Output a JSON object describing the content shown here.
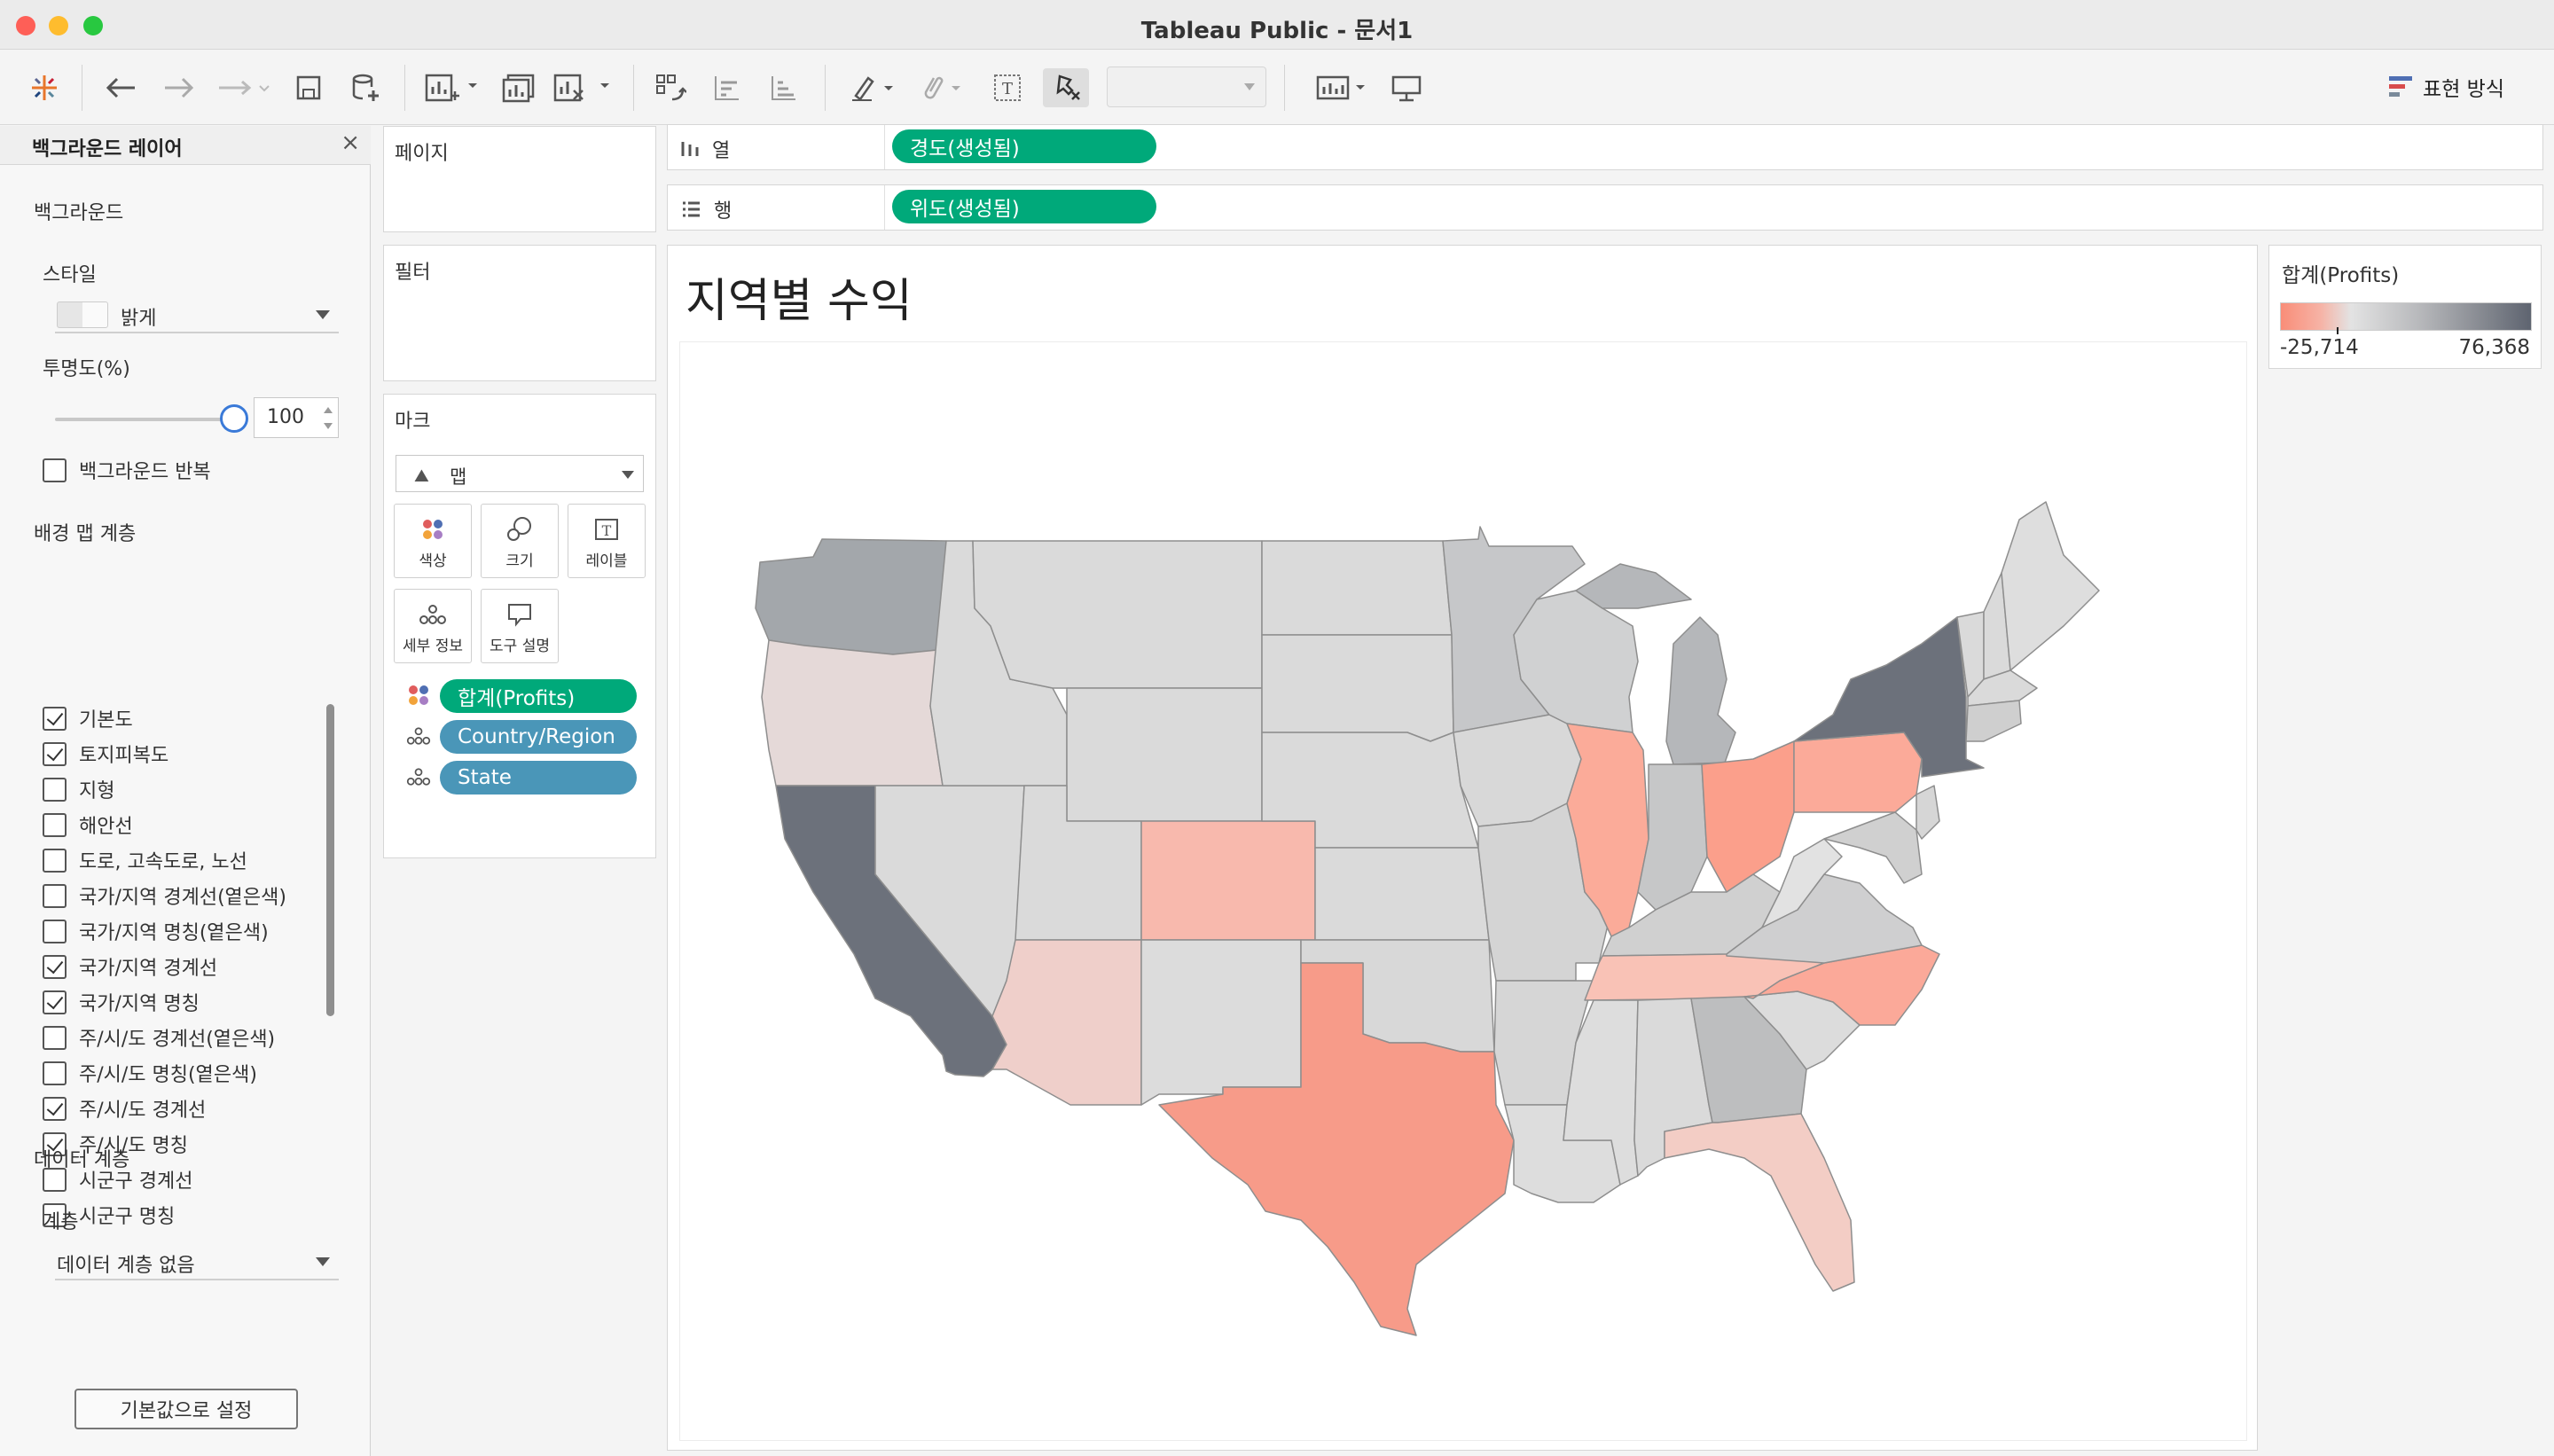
{
  "window": {
    "title": "Tableau Public - 문서1"
  },
  "toolbar": {
    "show_me_label": "표현 방식"
  },
  "background_panel": {
    "title": "백그라운드 레이어",
    "background_section": "백그라운드",
    "style_label": "스타일",
    "style_value": "밝게",
    "opacity_label": "투명도(%)",
    "opacity_value": "100",
    "opacity": 1.0,
    "repeat_label": "백그라운드 반복",
    "repeat_checked": false,
    "map_layers_section": "배경 맵 계층",
    "layers": [
      {
        "label": "기본도",
        "checked": true
      },
      {
        "label": "토지피복도",
        "checked": true
      },
      {
        "label": "지형",
        "checked": false
      },
      {
        "label": "해안선",
        "checked": false
      },
      {
        "label": "도로, 고속도로, 노선",
        "checked": false
      },
      {
        "label": "국가/지역 경계선(옅은색)",
        "checked": false
      },
      {
        "label": "국가/지역 명칭(옅은색)",
        "checked": false
      },
      {
        "label": "국가/지역 경계선",
        "checked": true
      },
      {
        "label": "국가/지역 명칭",
        "checked": true
      },
      {
        "label": "주/시/도 경계선(옅은색)",
        "checked": false
      },
      {
        "label": "주/시/도 명칭(옅은색)",
        "checked": false
      },
      {
        "label": "주/시/도 경계선",
        "checked": true
      },
      {
        "label": "주/시/도 명칭",
        "checked": true
      },
      {
        "label": "시군구 경계선",
        "checked": false
      },
      {
        "label": "시군구 명칭",
        "checked": false
      }
    ],
    "data_layer_section": "데이터 계층",
    "layer_label": "계층",
    "layer_value": "데이터 계층 없음",
    "reset_button": "기본값으로 설정"
  },
  "cards": {
    "pages": "페이지",
    "filters": "필터",
    "marks": "마크",
    "mark_type": "맵",
    "mark_buttons": {
      "color": "색상",
      "size": "크기",
      "label": "레이블",
      "detail": "세부 정보",
      "tooltip": "도구 설명"
    },
    "mark_pills": [
      "합계(Profits)",
      "Country/Region",
      "State"
    ]
  },
  "shelves": {
    "columns_label": "열",
    "columns_pill": "경도(생성됨)",
    "rows_label": "행",
    "rows_pill": "위도(생성됨)"
  },
  "view": {
    "title": "지역별 수익"
  },
  "legend": {
    "title": "합계(Profits)",
    "min": "-25,714",
    "max": "76,368"
  },
  "colors": {
    "pill_green": "#00a97a",
    "pill_blue": "#4a96b8",
    "loss": "#f98d78",
    "profit_high": "#5e6470",
    "neutral": "#e3e3e3"
  }
}
